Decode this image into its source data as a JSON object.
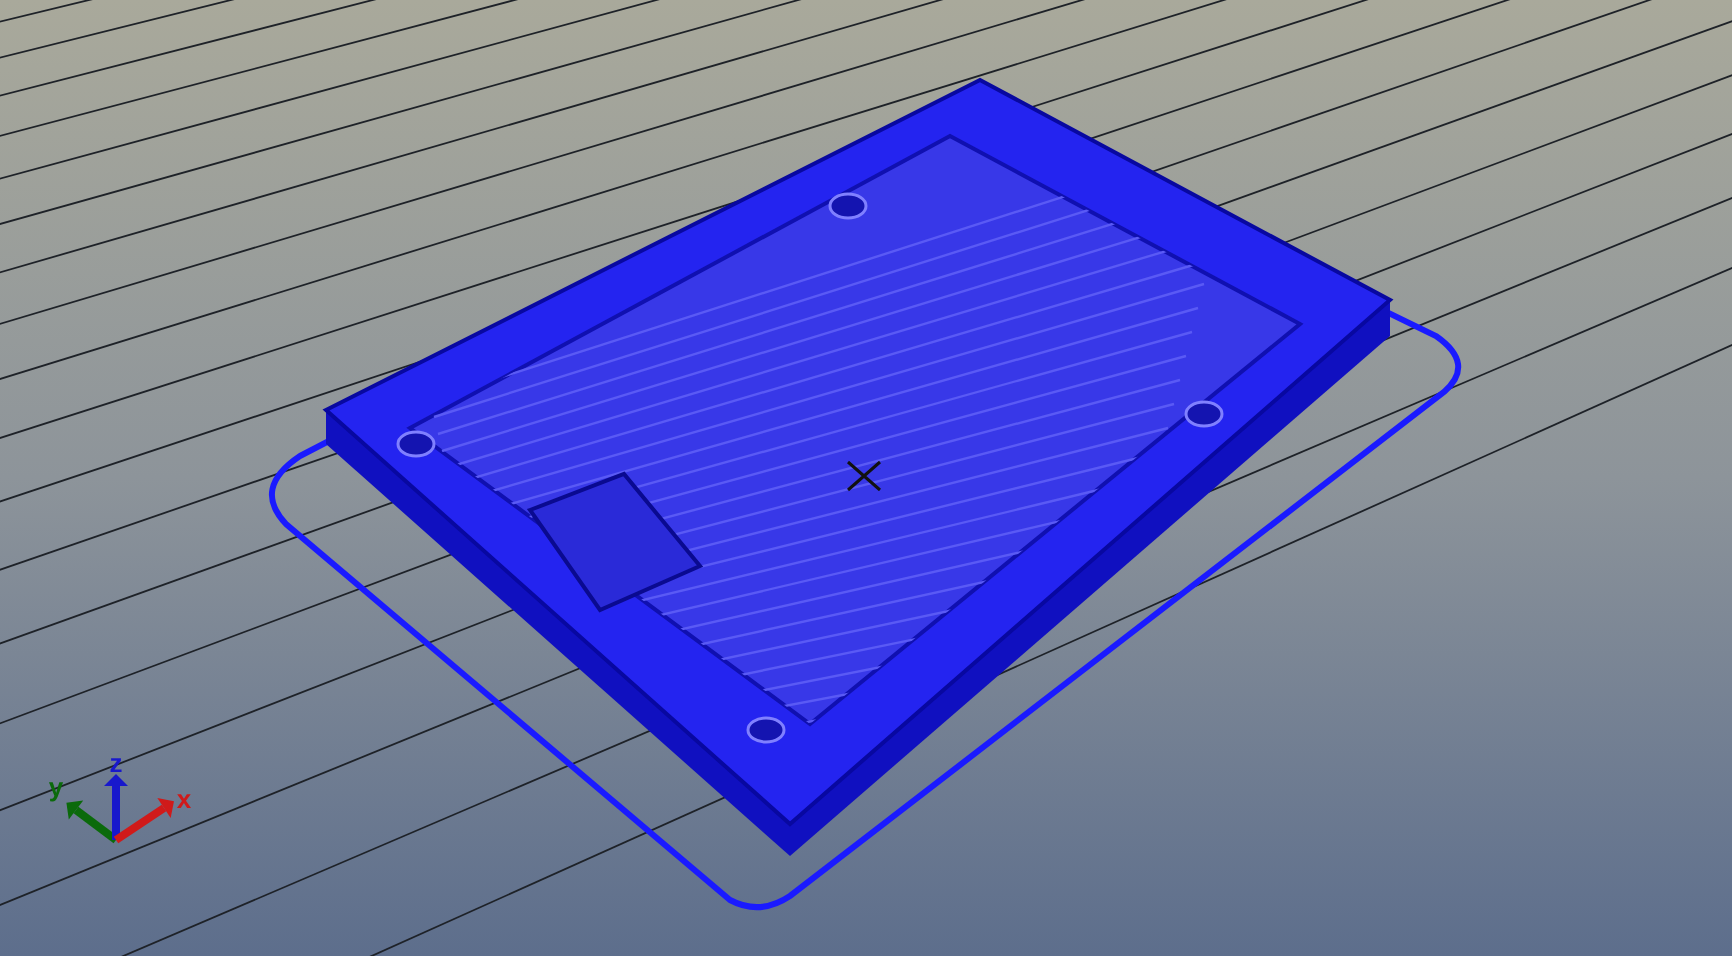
{
  "viewport": {
    "axes": [
      {
        "kind": "y",
        "label": "y",
        "color": "#0b6a0b"
      },
      {
        "kind": "z",
        "label": "z",
        "color": "#1818cc"
      },
      {
        "kind": "x",
        "label": "x",
        "color": "#d01a1a"
      }
    ]
  }
}
